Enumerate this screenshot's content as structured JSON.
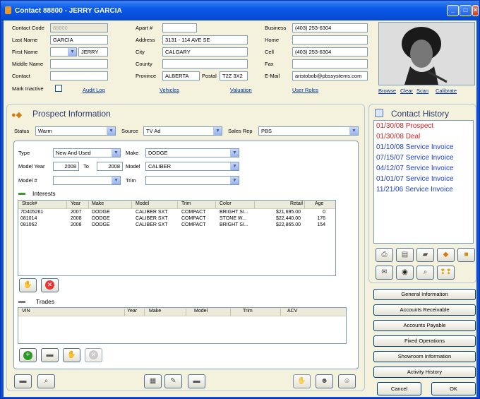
{
  "window": {
    "title": "Contact 88800 - JERRY GARCIA"
  },
  "contact": {
    "code_label": "Contact Code",
    "code_value": "88800",
    "last_name_label": "Last Name",
    "last_name": "GARCIA",
    "first_name_label": "First Name",
    "first_name": "JERRY",
    "middle_name_label": "Middle Name",
    "middle_name": "",
    "contact_label": "Contact",
    "contact_value": "",
    "mark_inactive_label": "Mark Inactive",
    "apart_label": "Apart #",
    "apart_value": "",
    "address_label": "Address",
    "address": "3131 - 114 AVE SE",
    "city_label": "City",
    "city": "CALGARY",
    "county_label": "County",
    "county": "",
    "province_label": "Province",
    "province": "ALBERTA",
    "postal_label": "Postal",
    "postal": "T2Z 3X2",
    "business_label": "Business",
    "business": "(403) 253-6304",
    "home_label": "Home",
    "home": "",
    "cell_label": "Cell",
    "cell": "(403) 253-6304",
    "fax_label": "Fax",
    "fax": "",
    "email_label": "E-Mail",
    "email": "aristobob@pbssystems.com",
    "links": {
      "audit": "Audit Log",
      "vehicles": "Vehicles",
      "valuation": "Valuation",
      "user_roles": "User Roles",
      "browse": "Browse",
      "clear": "Clear",
      "scan": "Scan",
      "calibrate": "Calibrate"
    }
  },
  "prospect": {
    "title": "Prospect Information",
    "status_label": "Status",
    "status": "Warm",
    "source_label": "Source",
    "source": "TV Ad",
    "salesrep_label": "Sales Rep",
    "salesrep": "PBS",
    "type_label": "Type",
    "type": "New And Used",
    "make_label": "Make",
    "make": "DODGE",
    "model_year_label": "Model Year",
    "year_from": "2008",
    "to_label": "To",
    "year_to": "2008",
    "model_label": "Model",
    "model": "CALIBER",
    "model_num_label": "Model #",
    "model_num": "",
    "trim_label": "Trim",
    "trim": "",
    "interests_title": "Interests",
    "interests_headers": [
      "Stock#",
      "Year",
      "Make",
      "Model",
      "Trim",
      "Color",
      "Retail",
      "Age"
    ],
    "interests_rows": [
      [
        "7D405261",
        "2007",
        "DODGE",
        "CALIBER SXT",
        "COMPACT",
        "BRIGHT SI...",
        "$21,695.00",
        "0"
      ],
      [
        "081014",
        "2008",
        "DODGE",
        "CALIBER SXT",
        "COMPACT",
        "STONE W...",
        "$22,440.00",
        "176"
      ],
      [
        "081062",
        "2008",
        "DODGE",
        "CALIBER SXT",
        "COMPACT",
        "BRIGHT SI...",
        "$22,865.00",
        "154"
      ]
    ],
    "trades_title": "Trades",
    "trades_headers": [
      "VIN",
      "Year",
      "Make",
      "Model",
      "Trim",
      "ACV"
    ]
  },
  "history": {
    "title": "Contact History",
    "items": [
      {
        "text": "01/30/08 Prospect",
        "color": "#e02020"
      },
      {
        "text": "01/30/08 Deal",
        "color": "#e02020"
      },
      {
        "text": "01/10/08 Service Invoice",
        "color": "#1f3fd6"
      },
      {
        "text": "07/15/07 Service Invoice",
        "color": "#1f3fd6"
      },
      {
        "text": "04/12/07 Service Invoice",
        "color": "#1f3fd6"
      },
      {
        "text": "01/01/07 Service Invoice",
        "color": "#1f3fd6"
      },
      {
        "text": "11/21/06 Service Invoice",
        "color": "#1f3fd6"
      }
    ]
  },
  "side_buttons": [
    "General Information",
    "Accounts Receivable",
    "Accounts Payable",
    "Fixed Operations",
    "Showroom Information",
    "Activity History"
  ],
  "footer": {
    "cancel": "Cancel",
    "ok": "OK"
  }
}
